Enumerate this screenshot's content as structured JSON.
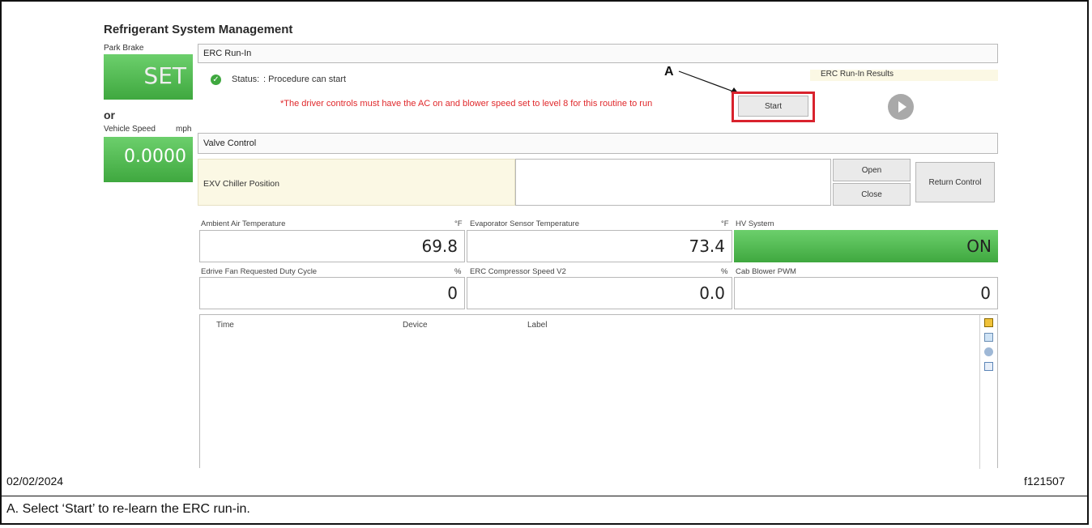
{
  "window": {
    "title": "Refrigerant System Management"
  },
  "left_panel": {
    "park_brake_label": "Park Brake",
    "park_brake_value": "SET",
    "or_text": "or",
    "vehicle_speed_label": "Vehicle Speed",
    "vehicle_speed_unit": "mph",
    "vehicle_speed_value": "0.0000"
  },
  "erc_runin": {
    "header": "ERC Run-In",
    "status_label": "Status:",
    "status_text": ": Procedure can start",
    "warning": "*The driver controls must have the AC on and blower speed set to level 8 for this routine to run",
    "start_label": "Start",
    "results_label": "ERC Run-In Results",
    "callout": "A"
  },
  "valve_control": {
    "header": "Valve Control",
    "exv_label": "EXV Chiller Position",
    "open_label": "Open",
    "close_label": "Close",
    "return_label": "Return Control"
  },
  "readings": {
    "ambient_label": "Ambient Air Temperature",
    "ambient_unit": "°F",
    "ambient_value": "69.8",
    "evap_label": "Evaporator Sensor Temperature",
    "evap_unit": "°F",
    "evap_value": "73.4",
    "hv_label": "HV System",
    "hv_value": "ON",
    "fan_label": "Edrive Fan Requested Duty Cycle",
    "fan_unit": "%",
    "fan_value": "0",
    "comp_label": "ERC Compressor Speed V2",
    "comp_unit": "%",
    "comp_value": "0.0",
    "blower_label": "Cab Blower PWM",
    "blower_value": "0"
  },
  "log_table": {
    "columns": [
      "Time",
      "Device",
      "Label"
    ]
  },
  "toolbar_icons": [
    "flag-icon",
    "export-icon",
    "globe-icon",
    "calendar-icon"
  ],
  "colors": {
    "green": "#4db34d",
    "callout_red": "#d9232d",
    "warning_red": "#e0282b"
  },
  "footer": {
    "date": "02/02/2024",
    "figure_id": "f121507",
    "caption": "A.  Select ‘Start’ to re-learn the ERC run-in."
  }
}
